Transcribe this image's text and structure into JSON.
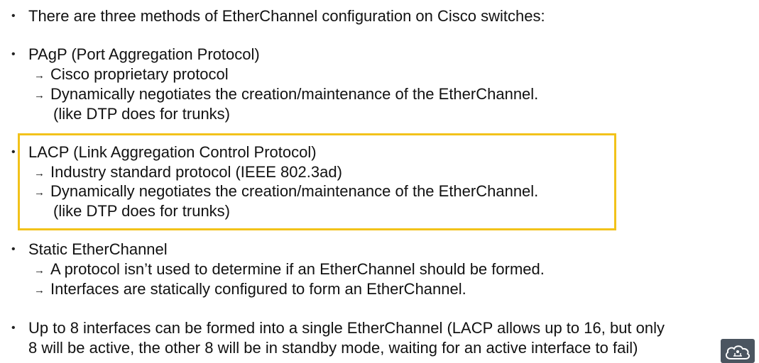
{
  "intro": {
    "text": "There are three methods of EtherChannel configuration on Cisco switches:"
  },
  "pagp": {
    "title": "PAgP (Port Aggregation Protocol)",
    "points": [
      "Cisco proprietary protocol",
      "Dynamically negotiates the creation/maintenance of the EtherChannel."
    ],
    "note": "(like DTP does for trunks)"
  },
  "lacp": {
    "title": "LACP (Link Aggregation Control Protocol)",
    "points": [
      "Industry standard protocol (IEEE 802.3ad)",
      "Dynamically negotiates the creation/maintenance of the EtherChannel."
    ],
    "note": "(like DTP does for trunks)",
    "highlight_color": "#f2c21a"
  },
  "static": {
    "title": "Static EtherChannel",
    "points": [
      "A protocol isn’t used to determine if an EtherChannel should be formed.",
      "Interfaces are statically configured to form an EtherChannel."
    ]
  },
  "limit": {
    "line1": "Up to 8 interfaces can be formed into a single EtherChannel (LACP allows up to 16, but only",
    "line2": "8 will be active, the other 8 will be in standby mode, waiting for an active interface to fail)"
  },
  "symbols": {
    "bullet": "•",
    "arrow": "→"
  },
  "icons": {
    "corner_logo": "cloud-network-icon"
  }
}
